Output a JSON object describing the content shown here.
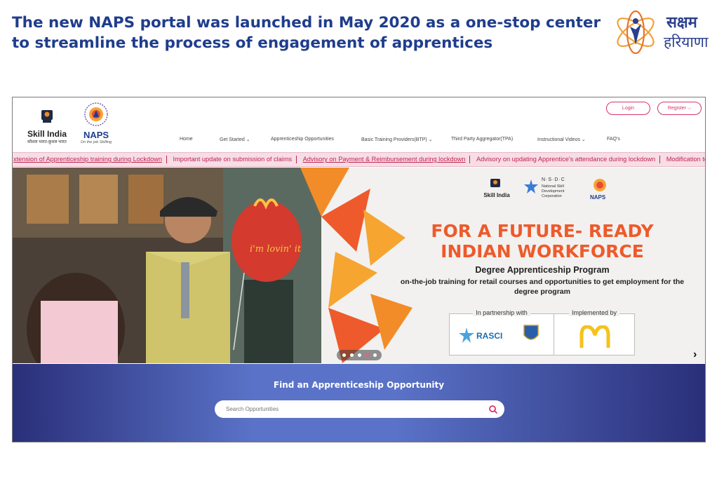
{
  "slide": {
    "title_line1": "The new NAPS portal was launched in May 2020 as a one-stop center",
    "title_line2": "to streamline the process of engagement of apprentices",
    "brand_line1": "सक्षम",
    "brand_line2": "हरियाणा"
  },
  "portal": {
    "logos": {
      "skill_india_name": "Skill India",
      "skill_india_tagline": "कौशल भारत-कुशल भारत",
      "naps_name": "NAPS",
      "naps_tagline": "On the job Skilling"
    },
    "header_buttons": {
      "login": "Login",
      "register": "Register ⌵"
    },
    "nav": [
      {
        "label": "Home"
      },
      {
        "label": "Get Started ⌄"
      },
      {
        "label": "Apprenticeship Opportunities"
      },
      {
        "label": "Basic Training Providers(BTP) ⌄"
      },
      {
        "label": "Third Party Aggregator(TPA)"
      },
      {
        "label": "Instructional Videos ⌄"
      },
      {
        "label": "FAQ's"
      }
    ],
    "ticker": [
      "xtension of Apprenticeship training during Lockdown",
      "Important update on submission of claims",
      "Advisory on Payment & Reimbursement during lockdown",
      "Advisory on updating Apprentice's attendance during lockdown",
      "Modification to stipen"
    ],
    "banner": {
      "partner_skill_india": "Skill India",
      "partner_nsdc": "N·S·D·C",
      "partner_nsdc_sub": "National Skill Development Corporation",
      "partner_naps": "NAPS",
      "headline_1": "FOR A FUTURE- READY",
      "headline_2": "INDIAN WORKFORCE",
      "subhead": "Degree Apprenticeship Program",
      "description": "on-the-job training for retail courses and opportunities to get employment for the degree program",
      "partnership_label": "In partnership with",
      "rasci": "RASCI",
      "implemented_label": "Implemented by",
      "balloon_text": "i'm lovin' it",
      "slide_count": 5,
      "active_slide": 4
    },
    "search": {
      "title": "Find an Apprenticeship Opportunity",
      "placeholder": "Search Opportunities"
    }
  },
  "colors": {
    "title_blue": "#1f3d8c",
    "accent_pink": "#d6336c",
    "headline_orange": "#ee5a2b",
    "search_gradient_edge": "#2a2f79",
    "search_gradient_mid": "#5a73c8"
  }
}
